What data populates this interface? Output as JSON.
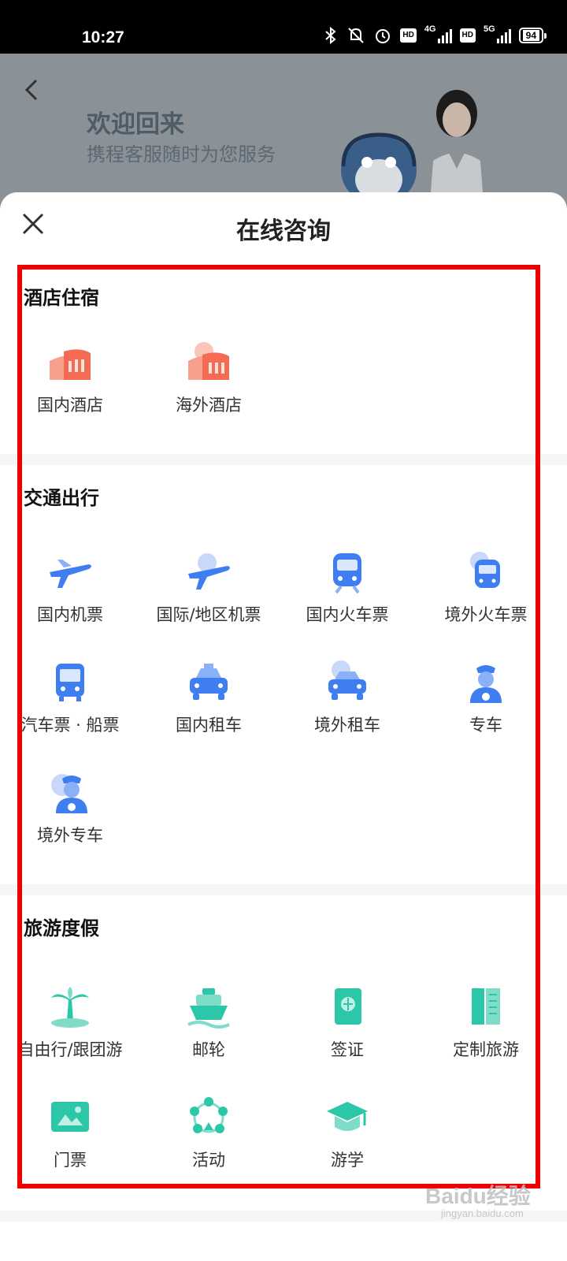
{
  "status_bar": {
    "time": "10:27",
    "battery": "94",
    "net1": "4G",
    "net2": "5G",
    "hd": "HD"
  },
  "header": {
    "title": "欢迎回来",
    "subtitle": "携程客服随时为您服务"
  },
  "sheet": {
    "title": "在线咨询"
  },
  "sections": [
    {
      "title": "酒店住宿",
      "items": [
        {
          "label": "国内酒店",
          "icon": "hotel-building-icon"
        },
        {
          "label": "海外酒店",
          "icon": "overseas-hotel-icon"
        }
      ]
    },
    {
      "title": "交通出行",
      "items": [
        {
          "label": "国内机票",
          "icon": "airplane-icon"
        },
        {
          "label": "国际/地区机票",
          "icon": "global-airplane-icon"
        },
        {
          "label": "国内火车票",
          "icon": "train-icon"
        },
        {
          "label": "境外火车票",
          "icon": "global-train-icon"
        },
        {
          "label": "汽车票 · 船票",
          "icon": "bus-icon"
        },
        {
          "label": "国内租车",
          "icon": "taxi-icon"
        },
        {
          "label": "境外租车",
          "icon": "global-car-icon"
        },
        {
          "label": "专车",
          "icon": "chauffeur-icon"
        },
        {
          "label": "境外专车",
          "icon": "global-chauffeur-icon"
        }
      ]
    },
    {
      "title": "旅游度假",
      "items": [
        {
          "label": "自由行/跟团游",
          "icon": "palm-tree-icon"
        },
        {
          "label": "邮轮",
          "icon": "cruise-ship-icon"
        },
        {
          "label": "签证",
          "icon": "visa-passport-icon"
        },
        {
          "label": "定制旅游",
          "icon": "custom-tour-icon"
        },
        {
          "label": "门票",
          "icon": "ticket-icon"
        },
        {
          "label": "活动",
          "icon": "activity-icon"
        },
        {
          "label": "游学",
          "icon": "study-tour-icon"
        }
      ]
    }
  ],
  "watermark": {
    "brand": "Baidu经验",
    "url": "jingyan.baidu.com"
  },
  "colors": {
    "hotel": "#f36b53",
    "transport": "#3f7ef0",
    "vacation": "#2cc7a8",
    "highlight": "#ee0000"
  }
}
